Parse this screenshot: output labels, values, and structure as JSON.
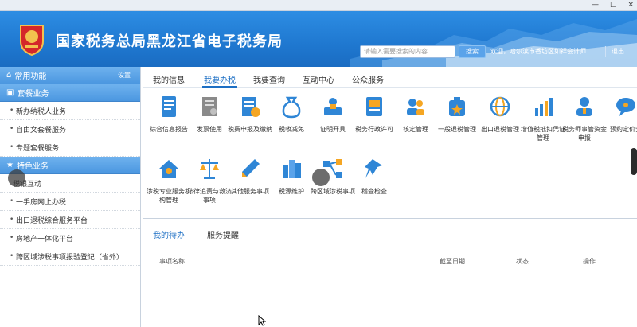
{
  "header": {
    "title": "国家税务总局黑龙江省电子税务局",
    "search_placeholder": "请输入需要搜索的内容",
    "search_label": "搜索",
    "welcome": "欢迎，哈尔滨市香坊区如祥会计师...",
    "logout_label": "退出",
    "brand_color": "#1f78d0"
  },
  "sidebar": {
    "common_label": "常用功能",
    "common_setting": "设置",
    "package_label": "套餐业务",
    "package_items": [
      "新办纳税人业务",
      "自由文套餐服务",
      "专题套餐服务"
    ],
    "special_label": "特色业务",
    "special_items": [
      "税银互动",
      "一手房网上办税",
      "出口退税综合服务平台",
      "房地产一体化平台",
      "跨区域涉税事项报验登记（省外）"
    ]
  },
  "tabs": [
    "我的信息",
    "我要办税",
    "我要查询",
    "互动中心",
    "公众服务"
  ],
  "active_tab": "我要办税",
  "services": [
    {
      "label": "综合信息报告",
      "icon": "document-icon"
    },
    {
      "label": "发票使用",
      "icon": "invoice-icon"
    },
    {
      "label": "税费申报及缴纳",
      "icon": "tax-report-icon"
    },
    {
      "label": "税收减免",
      "icon": "money-bag-icon"
    },
    {
      "label": "证明开具",
      "icon": "certificate-icon"
    },
    {
      "label": "税务行政许可",
      "icon": "license-icon"
    },
    {
      "label": "核定管理",
      "icon": "people-icon"
    },
    {
      "label": "一般退税管理",
      "icon": "refund-bag-icon"
    },
    {
      "label": "出口退税管理",
      "icon": "globe-icon"
    },
    {
      "label": "增值税抵扣凭证管理",
      "icon": "bar-chart-icon"
    },
    {
      "label": "税务师事管资金申报",
      "icon": "agent-icon"
    },
    {
      "label": "预约定价安",
      "icon": "speech-icon"
    },
    {
      "label": "涉税专业服务机构管理",
      "icon": "house-icon"
    },
    {
      "label": "法律追责与救济事项",
      "icon": "scale-icon"
    },
    {
      "label": "其他服务事项",
      "icon": "pen-icon"
    },
    {
      "label": "税源维护",
      "icon": "building-icon"
    },
    {
      "label": "跨区域涉税事项",
      "icon": "network-icon"
    },
    {
      "label": "稽查检查",
      "icon": "pin-icon"
    }
  ],
  "panel": {
    "tabs": [
      "我的待办",
      "服务提醒"
    ],
    "columns": [
      "事项名称",
      "截至日期",
      "状态",
      "操作"
    ]
  },
  "titlebar": {
    "minimize": "—",
    "maximize": "□",
    "close": "×"
  }
}
